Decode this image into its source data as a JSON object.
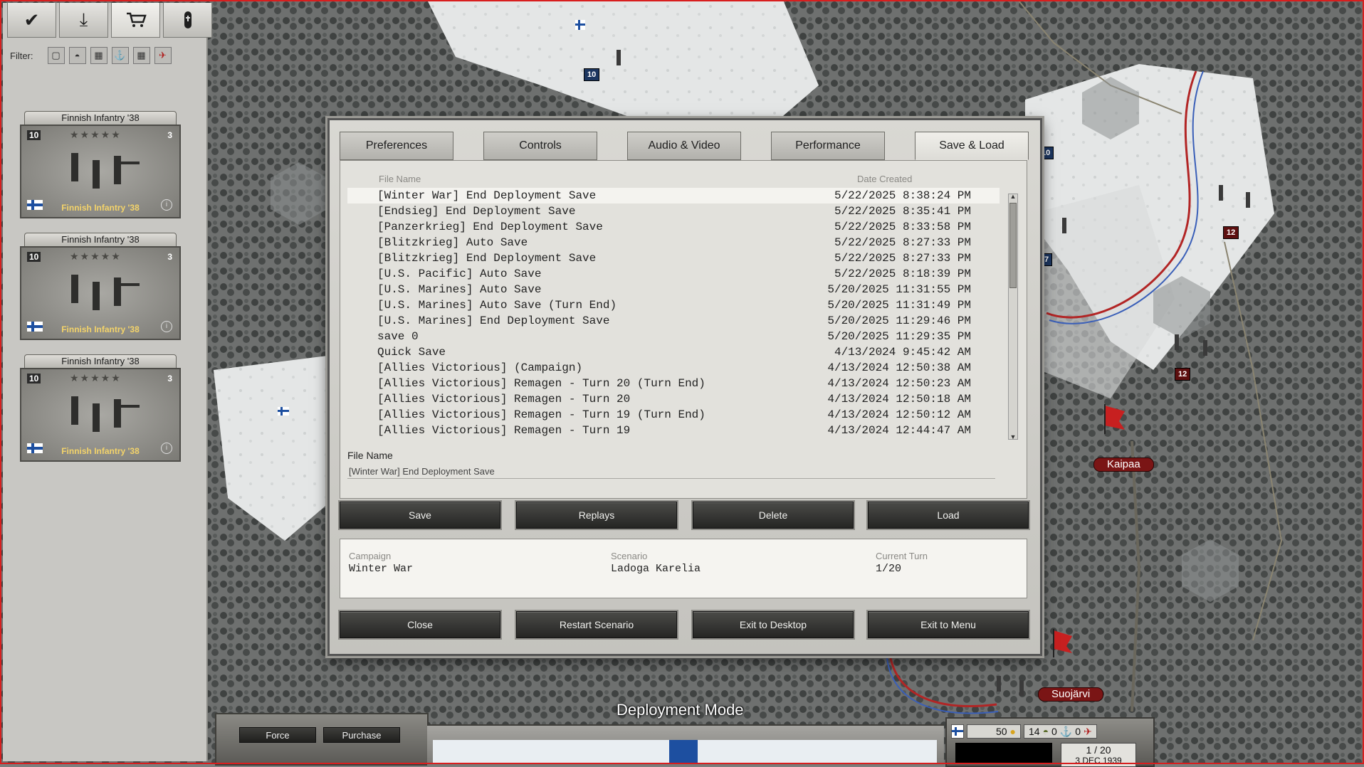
{
  "left_panel": {
    "tabs": [
      {
        "icon": "check-icon",
        "glyph": "✔"
      },
      {
        "icon": "download-icon",
        "glyph": "⤓"
      },
      {
        "icon": "cart-icon",
        "glyph": "🛒"
      },
      {
        "icon": "grave-icon",
        "glyph": "✝"
      }
    ],
    "filter_label": "Filter:",
    "filter_icons": [
      "all-units-icon",
      "infantry-icon",
      "armor-icon",
      "naval-icon",
      "artillery-icon",
      "aircraft-icon"
    ],
    "units": [
      {
        "title": "Finnish Infantry '38",
        "strength": "10",
        "stars": "★★★★★",
        "ammo": "3",
        "name": "Finnish Infantry '38"
      },
      {
        "title": "Finnish Infantry '38",
        "strength": "10",
        "stars": "★★★★★",
        "ammo": "3",
        "name": "Finnish Infantry '38"
      },
      {
        "title": "Finnish Infantry '38",
        "strength": "10",
        "stars": "★★★★★",
        "ammo": "3",
        "name": "Finnish Infantry '38"
      }
    ]
  },
  "dialog": {
    "tabs": [
      "Preferences",
      "Controls",
      "Audio & Video",
      "Performance",
      "Save & Load"
    ],
    "active_tab": "Save & Load",
    "columns": {
      "file_name": "File Name",
      "date_created": "Date Created"
    },
    "files": [
      {
        "name": "[Winter War] End Deployment Save",
        "date": "5/22/2025 8:38:24 PM"
      },
      {
        "name": "[Endsieg] End Deployment Save",
        "date": "5/22/2025 8:35:41 PM"
      },
      {
        "name": "[Panzerkrieg] End Deployment Save",
        "date": "5/22/2025 8:33:58 PM"
      },
      {
        "name": "[Blitzkrieg] Auto Save",
        "date": "5/22/2025 8:27:33 PM"
      },
      {
        "name": "[Blitzkrieg] End Deployment Save",
        "date": "5/22/2025 8:27:33 PM"
      },
      {
        "name": "[U.S. Pacific] Auto Save",
        "date": "5/22/2025 8:18:39 PM"
      },
      {
        "name": "[U.S. Marines] Auto Save",
        "date": "5/20/2025 11:31:55 PM"
      },
      {
        "name": "[U.S. Marines] Auto Save (Turn End)",
        "date": "5/20/2025 11:31:49 PM"
      },
      {
        "name": "[U.S. Marines] End Deployment Save",
        "date": "5/20/2025 11:29:46 PM"
      },
      {
        "name": "save 0",
        "date": "5/20/2025 11:29:35 PM"
      },
      {
        "name": "Quick Save",
        "date": "4/13/2024 9:45:42 AM"
      },
      {
        "name": "[Allies Victorious] (Campaign)",
        "date": "4/13/2024 12:50:38 AM"
      },
      {
        "name": "[Allies Victorious] Remagen - Turn 20 (Turn End)",
        "date": "4/13/2024 12:50:23 AM"
      },
      {
        "name": "[Allies Victorious] Remagen - Turn 20",
        "date": "4/13/2024 12:50:18 AM"
      },
      {
        "name": "[Allies Victorious] Remagen - Turn 19 (Turn End)",
        "date": "4/13/2024 12:50:12 AM"
      },
      {
        "name": "[Allies Victorious] Remagen - Turn 19",
        "date": "4/13/2024 12:44:47 AM"
      }
    ],
    "file_name_label": "File Name",
    "file_name_value": "[Winter War] End Deployment Save",
    "buttons": {
      "save": "Save",
      "replays": "Replays",
      "delete": "Delete",
      "load": "Load"
    },
    "info": {
      "campaign_label": "Campaign",
      "campaign_value": "Winter War",
      "scenario_label": "Scenario",
      "scenario_value": "Ladoga Karelia",
      "turn_label": "Current Turn",
      "turn_value": "1/20"
    },
    "bottom_buttons": {
      "close": "Close",
      "restart": "Restart Scenario",
      "exit_desktop": "Exit to Desktop",
      "exit_menu": "Exit to Menu"
    }
  },
  "hud": {
    "mode": "Deployment Mode",
    "force_label": "Force",
    "purchase_label": "Purchase",
    "prestige": "50",
    "res2": "14",
    "res3": "0",
    "res4": "0",
    "turn": "1 / 20",
    "date": "3 DEC 1939"
  },
  "map": {
    "labels": [
      "Kaipaa",
      "Suojärvi"
    ],
    "badges": [
      "10",
      "12",
      "12",
      "7",
      "10"
    ]
  },
  "colors": {
    "frame": "#d81e1e",
    "soviet": "#7a1515",
    "finnish_blue": "#1d4fa0"
  }
}
